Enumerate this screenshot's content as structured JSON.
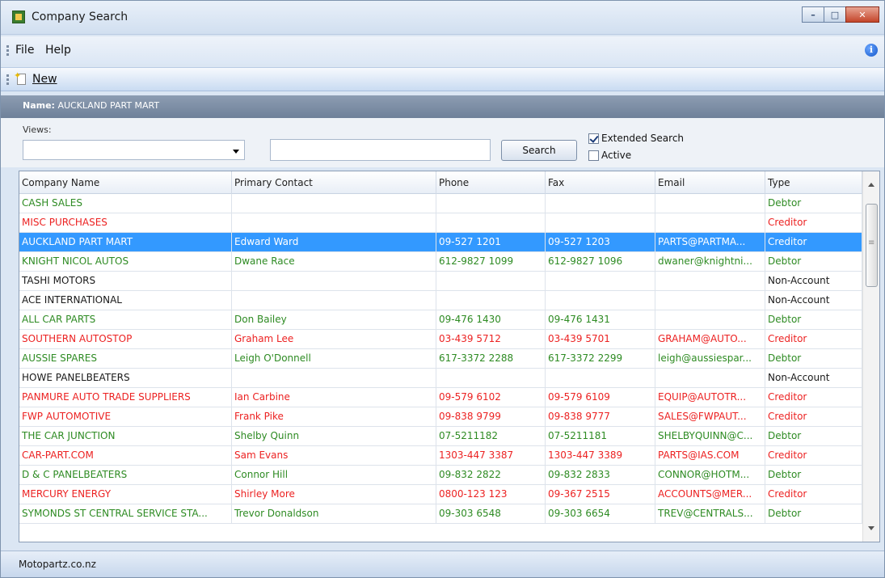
{
  "window": {
    "title": "Company Search"
  },
  "menu": {
    "items": [
      "File",
      "Help"
    ]
  },
  "toolbar": {
    "new_label": "New"
  },
  "header": {
    "label": "Name:",
    "value": "AUCKLAND PART MART"
  },
  "filters": {
    "views_label": "Views:",
    "views_selected": "",
    "search_value": "",
    "search_button": "Search",
    "extended_search_label": "Extended Search",
    "extended_search_checked": true,
    "active_label": "Active",
    "active_checked": false
  },
  "table": {
    "columns": [
      "Company Name",
      "Primary Contact",
      "Phone",
      "Fax",
      "Email",
      "Type"
    ],
    "selected_index": 2,
    "rows": [
      {
        "type_key": "debtor",
        "cells": [
          "CASH SALES",
          "",
          "",
          "",
          "",
          "Debtor"
        ]
      },
      {
        "type_key": "creditor",
        "cells": [
          "MISC PURCHASES",
          "",
          "",
          "",
          "",
          "Creditor"
        ]
      },
      {
        "type_key": "creditor",
        "cells": [
          "AUCKLAND PART MART",
          "Edward Ward",
          "09-527 1201",
          "09-527 1203",
          "PARTS@PARTMA...",
          "Creditor"
        ]
      },
      {
        "type_key": "debtor",
        "cells": [
          "KNIGHT NICOL AUTOS",
          "Dwane Race",
          "612-9827 1099",
          "612-9827 1096",
          "dwaner@knightni...",
          "Debtor"
        ]
      },
      {
        "type_key": "nonaccount",
        "cells": [
          "TASHI MOTORS",
          "",
          "",
          "",
          "",
          "Non-Account"
        ]
      },
      {
        "type_key": "nonaccount",
        "cells": [
          "ACE INTERNATIONAL",
          "",
          "",
          "",
          "",
          "Non-Account"
        ]
      },
      {
        "type_key": "debtor",
        "cells": [
          "ALL CAR PARTS",
          "Don Bailey",
          "09-476 1430",
          "09-476 1431",
          "",
          "Debtor"
        ]
      },
      {
        "type_key": "creditor",
        "cells": [
          "SOUTHERN AUTOSTOP",
          "Graham Lee",
          "03-439 5712",
          "03-439 5701",
          "GRAHAM@AUTO...",
          "Creditor"
        ]
      },
      {
        "type_key": "debtor",
        "cells": [
          "AUSSIE SPARES",
          "Leigh O'Donnell",
          "617-3372 2288",
          "617-3372 2299",
          "leigh@aussiespar...",
          "Debtor"
        ]
      },
      {
        "type_key": "nonaccount",
        "cells": [
          "HOWE PANELBEATERS",
          "",
          "",
          "",
          "",
          "Non-Account"
        ]
      },
      {
        "type_key": "creditor",
        "cells": [
          "PANMURE AUTO TRADE SUPPLIERS",
          "Ian Carbine",
          "09-579 6102",
          "09-579 6109",
          "EQUIP@AUTOTR...",
          "Creditor"
        ]
      },
      {
        "type_key": "creditor",
        "cells": [
          "FWP AUTOMOTIVE",
          "Frank Pike",
          "09-838 9799",
          "09-838 9777",
          "SALES@FWPAUT...",
          "Creditor"
        ]
      },
      {
        "type_key": "debtor",
        "cells": [
          "THE CAR JUNCTION",
          "Shelby Quinn",
          "07-5211182",
          "07-5211181",
          "SHELBYQUINN@C...",
          "Debtor"
        ]
      },
      {
        "type_key": "creditor",
        "cells": [
          "CAR-PART.COM",
          "Sam Evans",
          "1303-447 3387",
          "1303-447 3389",
          "PARTS@IAS.COM",
          "Creditor"
        ]
      },
      {
        "type_key": "debtor",
        "cells": [
          "D & C PANELBEATERS",
          "Connor Hill",
          "09-832 2822",
          "09-832 2833",
          "CONNOR@HOTM...",
          "Debtor"
        ]
      },
      {
        "type_key": "creditor",
        "cells": [
          "MERCURY ENERGY",
          "Shirley More",
          "0800-123 123",
          "09-367 2515",
          "ACCOUNTS@MER...",
          "Creditor"
        ]
      },
      {
        "type_key": "debtor",
        "cells": [
          "SYMONDS ST CENTRAL SERVICE STA...",
          "Trevor Donaldson",
          "09-303 6548",
          "09-303 6654",
          "TREV@CENTRALS...",
          "Debtor"
        ]
      }
    ]
  },
  "status": {
    "text": "Motopartz.co.nz"
  },
  "colors": {
    "debtor": "#2e8b23",
    "creditor": "#ec2222",
    "non_account": "#1a1a1a",
    "selection": "#3399ff",
    "header_band": "#6e8199"
  }
}
